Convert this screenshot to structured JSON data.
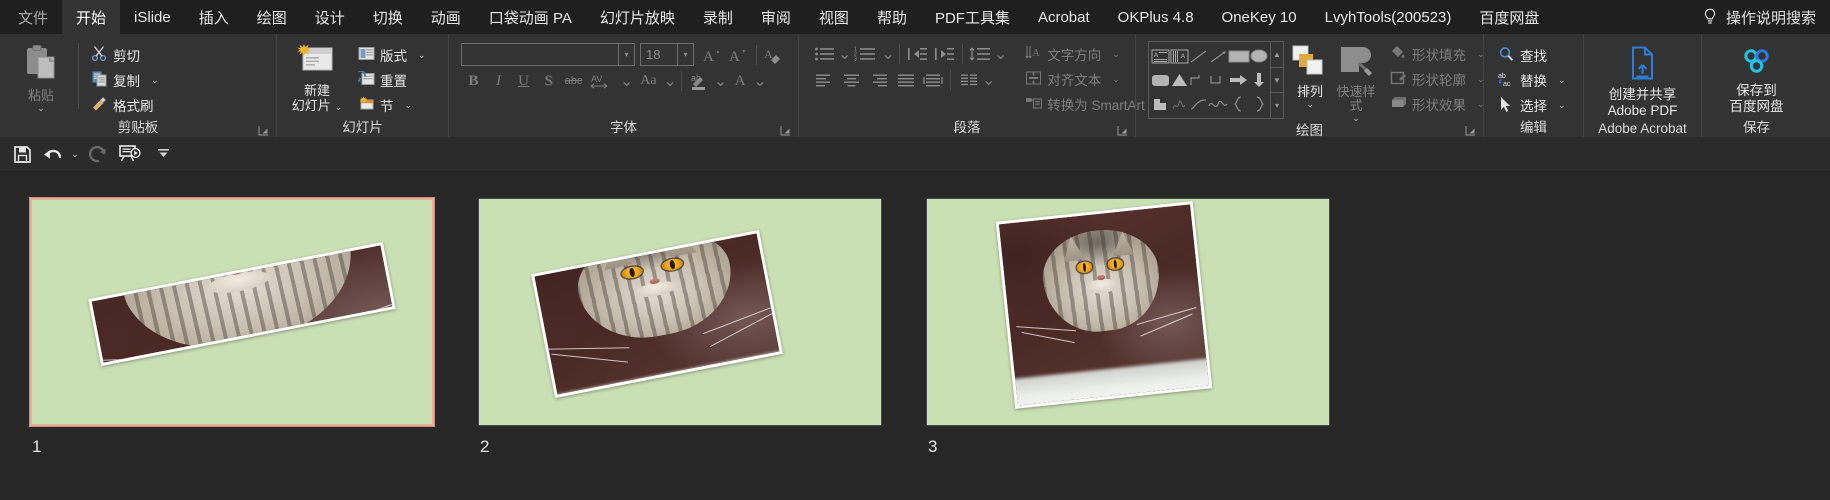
{
  "app": {
    "theme_bg": "#272727",
    "ribbon_bg": "#333333",
    "tabbar_bg": "#1f1f1f"
  },
  "tabbar": {
    "tabs": [
      {
        "label": "文件",
        "state": "dim"
      },
      {
        "label": "开始",
        "state": "active"
      },
      {
        "label": "iSlide",
        "state": "normal"
      },
      {
        "label": "插入",
        "state": "normal"
      },
      {
        "label": "绘图",
        "state": "normal"
      },
      {
        "label": "设计",
        "state": "normal"
      },
      {
        "label": "切换",
        "state": "normal"
      },
      {
        "label": "动画",
        "state": "normal"
      },
      {
        "label": "口袋动画 PA",
        "state": "normal"
      },
      {
        "label": "幻灯片放映",
        "state": "normal"
      },
      {
        "label": "录制",
        "state": "normal"
      },
      {
        "label": "审阅",
        "state": "normal"
      },
      {
        "label": "视图",
        "state": "normal"
      },
      {
        "label": "帮助",
        "state": "normal"
      },
      {
        "label": "PDF工具集",
        "state": "normal"
      },
      {
        "label": "Acrobat",
        "state": "normal"
      },
      {
        "label": "OKPlus 4.8",
        "state": "normal"
      },
      {
        "label": "OneKey 10",
        "state": "normal"
      },
      {
        "label": "LvyhTools(200523)",
        "state": "normal"
      },
      {
        "label": "百度网盘",
        "state": "normal"
      }
    ],
    "search": {
      "label": "操作说明搜索",
      "icon": "lightbulb-icon"
    }
  },
  "ribbon": {
    "groups": [
      {
        "name": "clipboard",
        "label": "剪贴板",
        "has_launcher": true,
        "paste": {
          "label": "粘贴",
          "icon": "clipboard-icon",
          "disabled": true,
          "caret": "⌄"
        },
        "items": [
          {
            "label": "剪切",
            "icon": "scissors-icon",
            "disabled": false
          },
          {
            "label": "复制",
            "icon": "copy-icon",
            "disabled": false,
            "caret": "⌄"
          },
          {
            "label": "格式刷",
            "icon": "format-painter-icon",
            "disabled": false
          }
        ]
      },
      {
        "name": "slides",
        "label": "幻灯片",
        "has_launcher": false,
        "new_slide": {
          "label_line1": "新建",
          "label_line2": "幻灯片",
          "icon": "new-slide-icon",
          "caret": "⌄"
        },
        "items": [
          {
            "label": "版式",
            "icon": "layout-icon",
            "caret": "⌄"
          },
          {
            "label": "重置",
            "icon": "reset-icon"
          },
          {
            "label": "节",
            "icon": "section-icon",
            "caret": "⌄"
          }
        ]
      },
      {
        "name": "font",
        "label": "字体",
        "has_launcher": true,
        "font_name": {
          "value": "",
          "placeholder": ""
        },
        "font_size": {
          "value": "18"
        },
        "buttons_row1": [
          {
            "name": "increase-font-size",
            "glyph": "A▴"
          },
          {
            "name": "decrease-font-size",
            "glyph": "A▾"
          },
          {
            "name": "clear-formatting",
            "glyph": "clear-format-icon"
          }
        ],
        "buttons_row2": [
          {
            "name": "bold",
            "glyph": "B"
          },
          {
            "name": "italic",
            "glyph": "I"
          },
          {
            "name": "underline",
            "glyph": "U"
          },
          {
            "name": "shadow",
            "glyph": "S"
          },
          {
            "name": "strikethrough",
            "glyph": "abc"
          },
          {
            "name": "character-spacing",
            "glyph": "AV",
            "caret": "⌄"
          },
          {
            "name": "change-case",
            "glyph": "Aa",
            "caret": "⌄"
          },
          {
            "name": "text-highlight-color",
            "glyph": "ab",
            "caret": "⌄"
          },
          {
            "name": "font-color",
            "glyph": "A",
            "caret": "⌄"
          }
        ],
        "all_disabled": true
      },
      {
        "name": "paragraph",
        "label": "段落",
        "has_launcher": true,
        "buttons_row1": [
          {
            "name": "bullets",
            "caret": "⌄"
          },
          {
            "name": "numbering",
            "caret": "⌄"
          },
          {
            "name": "decrease-indent"
          },
          {
            "name": "increase-indent"
          },
          {
            "name": "line-spacing",
            "caret": "⌄"
          }
        ],
        "buttons_row2": [
          {
            "name": "align-left"
          },
          {
            "name": "align-center"
          },
          {
            "name": "align-right"
          },
          {
            "name": "justify"
          },
          {
            "name": "distribute"
          },
          {
            "name": "columns",
            "caret": "⌄"
          }
        ],
        "side_items": [
          {
            "label": "文字方向",
            "icon": "text-direction-icon",
            "caret": "⌄",
            "disabled": true
          },
          {
            "label": "对齐文本",
            "icon": "align-text-icon",
            "caret": "⌄",
            "disabled": true
          },
          {
            "label": "转换为 SmartArt",
            "icon": "smartart-icon",
            "caret": "⌄",
            "disabled": true
          }
        ]
      },
      {
        "name": "drawing",
        "label": "绘图",
        "has_launcher": true,
        "shapes_gallery": {
          "name": "shapes-gallery",
          "rows": 3,
          "cols": 6
        },
        "arrange": {
          "label": "排列",
          "icon": "arrange-icon",
          "caret": "⌄",
          "disabled": false
        },
        "quick_styles": {
          "label": "快速样式",
          "icon": "quick-styles-icon",
          "caret": "⌄",
          "disabled": true
        },
        "side_items": [
          {
            "label": "形状填充",
            "icon": "shape-fill-icon",
            "caret": "⌄",
            "disabled": true
          },
          {
            "label": "形状轮廓",
            "icon": "shape-outline-icon",
            "caret": "⌄",
            "disabled": true
          },
          {
            "label": "形状效果",
            "icon": "shape-effects-icon",
            "caret": "⌄",
            "disabled": true
          }
        ]
      },
      {
        "name": "editing",
        "label": "编辑",
        "has_launcher": false,
        "items": [
          {
            "label": "查找",
            "icon": "search-icon"
          },
          {
            "label": "替换",
            "icon": "replace-icon",
            "caret": "⌄"
          },
          {
            "label": "选择",
            "icon": "select-pointer-icon",
            "caret": "⌄"
          }
        ]
      },
      {
        "name": "adobe-acrobat",
        "label": "Adobe Acrobat",
        "has_launcher": false,
        "button": {
          "label_line1": "创建并共享",
          "label_line2": "Adobe PDF",
          "icon": "create-pdf-icon",
          "color": "#2a7fd4"
        }
      },
      {
        "name": "save",
        "label": "保存",
        "has_launcher": false,
        "button": {
          "label_line1": "保存到",
          "label_line2": "百度网盘",
          "icon": "baidu-netdisk-icon",
          "color": "#30c0e0"
        }
      }
    ]
  },
  "quick_access": {
    "items": [
      {
        "name": "save-button",
        "icon": "save-icon",
        "disabled": false
      },
      {
        "name": "undo-button",
        "icon": "undo-icon",
        "disabled": false,
        "caret": "⌄"
      },
      {
        "name": "redo-button",
        "icon": "redo-icon",
        "disabled": true
      },
      {
        "name": "start-from-beginning-button",
        "icon": "slideshow-icon",
        "disabled": false
      },
      {
        "name": "customize-quick-access-toolbar",
        "icon": "chevron-down-icon",
        "disabled": false
      }
    ]
  },
  "slide_sorter": {
    "background": "#272727",
    "selected_index": 1,
    "slide_bg_color": "#c9dfb4",
    "selection_border_color": "#e8b09a",
    "slides": [
      {
        "number": "1",
        "selected": true,
        "image": {
          "name": "cat-photo",
          "rotation_deg": -11,
          "crop": "wide-thin-strip"
        }
      },
      {
        "number": "2",
        "selected": false,
        "image": {
          "name": "cat-photo",
          "rotation_deg": -11,
          "crop": "landscape"
        }
      },
      {
        "number": "3",
        "selected": false,
        "image": {
          "name": "cat-photo",
          "rotation_deg": -6,
          "crop": "portrait-square"
        }
      }
    ]
  }
}
